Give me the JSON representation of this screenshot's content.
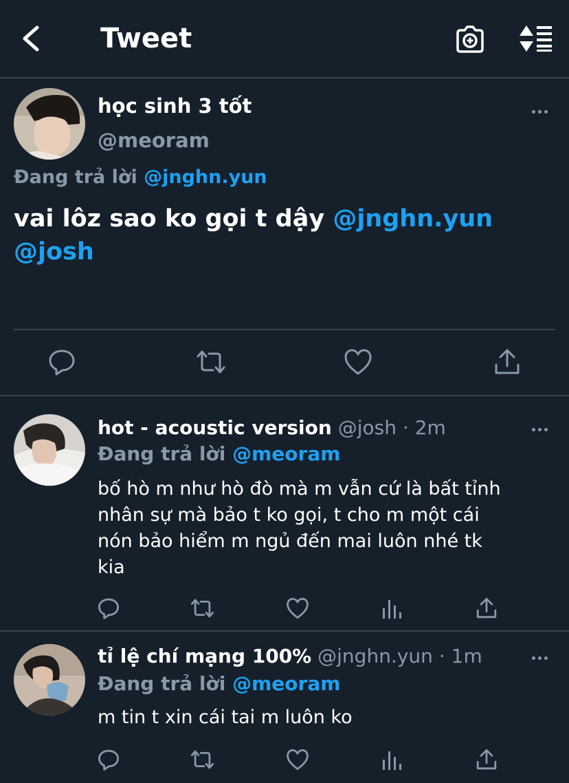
{
  "header": {
    "title": "Tweet",
    "back_icon": "chevron-left-icon",
    "camera_icon": "camera-add-icon",
    "sort_icon": "sort-replies-icon"
  },
  "main_tweet": {
    "display_name": "học sinh 3 tốt",
    "handle": "@meoram",
    "replying_prefix": "Đang trả lời",
    "replying_to": "@jnghn.yun",
    "text_plain": "vai lôz sao ko gọi t dậy",
    "mention_1": "@jnghn.yun",
    "mention_2": "@josh",
    "actions": [
      "reply-icon",
      "retweet-icon",
      "like-icon",
      "share-icon"
    ]
  },
  "replies": [
    {
      "display_name": "hot - acoustic version",
      "handle": "@josh",
      "sep": "·",
      "time": "2m",
      "replying_prefix": "Đang trả lời",
      "replying_to": "@meoram",
      "lines": [
        "bố hò m như hò đò mà m vẫn cứ là bất tỉnh",
        "nhân sự mà bảo t ko gọi, t cho m một cái",
        "nón bảo hiểm m ngủ đến mai luôn nhé tk",
        "kia"
      ],
      "actions": [
        "reply-icon",
        "retweet-icon",
        "like-icon",
        "analytics-icon",
        "share-icon"
      ]
    },
    {
      "display_name": "tỉ lệ chí mạng 100%",
      "handle": "@jnghn.yun",
      "sep": "·",
      "time": "1m",
      "replying_prefix": "Đang trả lời",
      "replying_to": "@meoram",
      "lines": [
        "m tin t xin cái tai m luôn ko"
      ],
      "actions": [
        "reply-icon",
        "retweet-icon",
        "like-icon",
        "analytics-icon",
        "share-icon"
      ]
    }
  ],
  "colors": {
    "background": "#15202b",
    "divider": "#38444d",
    "muted": "#8899a6",
    "accent": "#1da1f2",
    "text": "#ffffff"
  }
}
